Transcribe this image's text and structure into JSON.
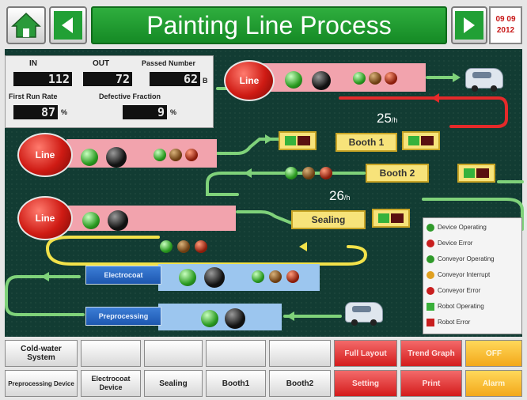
{
  "header": {
    "title": "Painting Line Process",
    "date_line1": "09 09",
    "date_line2": "2012"
  },
  "stats": {
    "in_label": "IN",
    "out_label": "OUT",
    "passed_label": "Passed Number",
    "in_value": "112",
    "out_value": "72",
    "passed_value": "62",
    "passed_unit": "B",
    "first_run_label": "First Run Rate",
    "defective_label": "Defective Fraction",
    "first_run_value": "87",
    "first_run_unit": "%",
    "defective_value": "9",
    "defective_unit": "%"
  },
  "process": {
    "line_a": "Line",
    "line_b": "Line",
    "line_c": "Line",
    "booth1": "Booth 1",
    "booth2": "Booth 2",
    "sealing": "Sealing",
    "rate1_value": "25",
    "rate1_unit": "/h",
    "rate2_value": "26",
    "rate2_unit": "/h",
    "electrocoat": "Electrocoat",
    "preprocessing": "Preprocessing"
  },
  "legend": [
    {
      "label": "Device Operating",
      "color": "#2f9a2a",
      "shape": "circle"
    },
    {
      "label": "Device Error",
      "color": "#c81e1e",
      "shape": "circle"
    },
    {
      "label": "Conveyor Operating",
      "color": "#2f9a2a",
      "shape": "circle"
    },
    {
      "label": "Conveyor Interrupt",
      "color": "#e0a020",
      "shape": "circle"
    },
    {
      "label": "Conveyor Error",
      "color": "#c81e1e",
      "shape": "circle"
    },
    {
      "label": "Robot Operating",
      "color": "#39b03a",
      "shape": "square"
    },
    {
      "label": "Robot Error",
      "color": "#c81e1e",
      "shape": "square"
    }
  ],
  "buttons_row1": [
    {
      "label": "Cold-water System",
      "style": "white"
    },
    {
      "label": "",
      "style": "white"
    },
    {
      "label": "",
      "style": "white"
    },
    {
      "label": "",
      "style": "white"
    },
    {
      "label": "",
      "style": "white"
    },
    {
      "label": "Full Layout",
      "style": "red"
    },
    {
      "label": "Trend Graph",
      "style": "red"
    },
    {
      "label": "OFF",
      "style": "orange"
    }
  ],
  "buttons_row2": [
    {
      "label": "Preprocessing Device",
      "style": "white"
    },
    {
      "label": "Electrocoat Device",
      "style": "white"
    },
    {
      "label": "Sealing",
      "style": "white"
    },
    {
      "label": "Booth1",
      "style": "white"
    },
    {
      "label": "Booth2",
      "style": "white"
    },
    {
      "label": "Setting",
      "style": "red"
    },
    {
      "label": "Print",
      "style": "red"
    },
    {
      "label": "Alarm",
      "style": "orange"
    }
  ],
  "colors": {
    "title_green": "#1f9a2f",
    "panel": "#123c33",
    "conveyor_green": "#7fd27a",
    "conveyor_red": "#e42a2a",
    "conveyor_yellow": "#f2e24a"
  }
}
